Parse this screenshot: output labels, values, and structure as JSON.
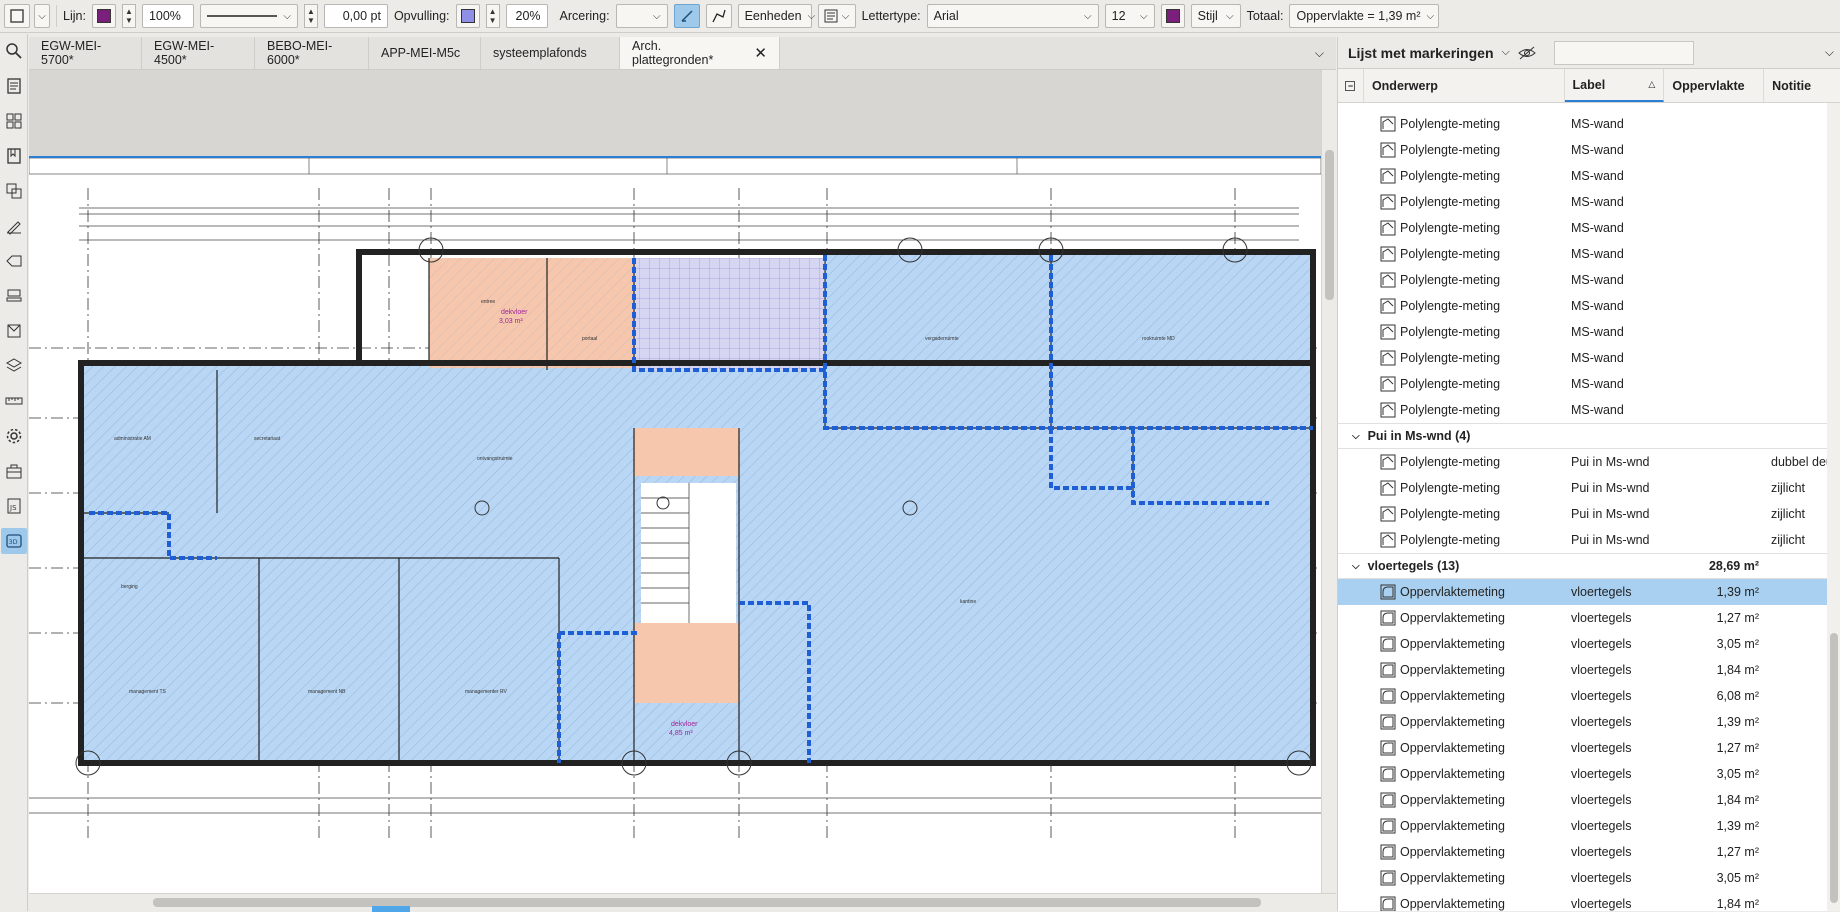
{
  "toolbar": {
    "lijn_label": "Lijn:",
    "lijn_color": "#7a1f7a",
    "opacity": "100%",
    "line_width": "0,00 pt",
    "opvulling_label": "Opvulling:",
    "fill_color": "#8f8fe8",
    "fill_opacity": "20%",
    "arcering_label": "Arcering:",
    "eenheden": "Eenheden",
    "lettertype_label": "Lettertype:",
    "font": "Arial",
    "font_size": "12",
    "text_color": "#7a1f7a",
    "stijl": "Stijl",
    "totaal_label": "Totaal:",
    "totaal_value": "Oppervlakte = 1,39 m²"
  },
  "tabs": [
    {
      "label": "EGW-MEI-5700*"
    },
    {
      "label": "EGW-MEI-4500*"
    },
    {
      "label": "BEBO-MEI-6000*"
    },
    {
      "label": "APP-MEI-M5c"
    },
    {
      "label": "systeemplafonds"
    },
    {
      "label": "Arch. plattegronden*"
    }
  ],
  "panel": {
    "title": "Lijst met markeringen",
    "columns": {
      "onderwerp": "Onderwerp",
      "label": "Label",
      "oppervlakte": "Oppervlakte",
      "notitie": "Notitie"
    },
    "ms_rows": [
      {
        "subject": "Polylengte-meting",
        "label": "MS-wand"
      },
      {
        "subject": "Polylengte-meting",
        "label": "MS-wand"
      },
      {
        "subject": "Polylengte-meting",
        "label": "MS-wand"
      },
      {
        "subject": "Polylengte-meting",
        "label": "MS-wand"
      },
      {
        "subject": "Polylengte-meting",
        "label": "MS-wand"
      },
      {
        "subject": "Polylengte-meting",
        "label": "MS-wand"
      },
      {
        "subject": "Polylengte-meting",
        "label": "MS-wand"
      },
      {
        "subject": "Polylengte-meting",
        "label": "MS-wand"
      },
      {
        "subject": "Polylengte-meting",
        "label": "MS-wand"
      },
      {
        "subject": "Polylengte-meting",
        "label": "MS-wand"
      },
      {
        "subject": "Polylengte-meting",
        "label": "MS-wand"
      },
      {
        "subject": "Polylengte-meting",
        "label": "MS-wand"
      }
    ],
    "group_pui": {
      "title": "Pui in Ms-wnd (4)"
    },
    "pui_rows": [
      {
        "subject": "Polylengte-meting",
        "label": "Pui in Ms-wnd",
        "note": "dubbel deur"
      },
      {
        "subject": "Polylengte-meting",
        "label": "Pui in Ms-wnd",
        "note": "zijlicht"
      },
      {
        "subject": "Polylengte-meting",
        "label": "Pui in Ms-wnd",
        "note": "zijlicht"
      },
      {
        "subject": "Polylengte-meting",
        "label": "Pui in Ms-wnd",
        "note": "zijlicht"
      }
    ],
    "group_vloer": {
      "title": "vloertegels (13)",
      "total": "28,69 m²"
    },
    "vloer_rows": [
      {
        "subject": "Oppervlaktemeting",
        "label": "vloertegels",
        "area": "1,39 m²"
      },
      {
        "subject": "Oppervlaktemeting",
        "label": "vloertegels",
        "area": "1,27 m²"
      },
      {
        "subject": "Oppervlaktemeting",
        "label": "vloertegels",
        "area": "3,05 m²"
      },
      {
        "subject": "Oppervlaktemeting",
        "label": "vloertegels",
        "area": "1,84 m²"
      },
      {
        "subject": "Oppervlaktemeting",
        "label": "vloertegels",
        "area": "6,08 m²"
      },
      {
        "subject": "Oppervlaktemeting",
        "label": "vloertegels",
        "area": "1,39 m²"
      },
      {
        "subject": "Oppervlaktemeting",
        "label": "vloertegels",
        "area": "1,27 m²"
      },
      {
        "subject": "Oppervlaktemeting",
        "label": "vloertegels",
        "area": "3,05 m²"
      },
      {
        "subject": "Oppervlaktemeting",
        "label": "vloertegels",
        "area": "1,84 m²"
      },
      {
        "subject": "Oppervlaktemeting",
        "label": "vloertegels",
        "area": "1,39 m²"
      },
      {
        "subject": "Oppervlaktemeting",
        "label": "vloertegels",
        "area": "1,27 m²"
      },
      {
        "subject": "Oppervlaktemeting",
        "label": "vloertegels",
        "area": "3,05 m²"
      },
      {
        "subject": "Oppervlaktemeting",
        "label": "vloertegels",
        "area": "1,84 m²"
      }
    ]
  },
  "plan": {
    "rooms": [
      {
        "name": "administratie AM"
      },
      {
        "name": "secretariaat"
      },
      {
        "name": "ontvangstruimte"
      },
      {
        "name": "vergaderruimte"
      },
      {
        "name": "rookruimte MD"
      },
      {
        "name": "kantine"
      },
      {
        "name": "berging"
      },
      {
        "name": "management TS"
      },
      {
        "name": "management NB"
      },
      {
        "name": "managementer RV"
      },
      {
        "name": "entree"
      },
      {
        "name": "portaal"
      },
      {
        "name": "dekvloer",
        "area": "3,03 m²"
      },
      {
        "name": "dekvloer",
        "area": "4,85 m²"
      }
    ]
  }
}
